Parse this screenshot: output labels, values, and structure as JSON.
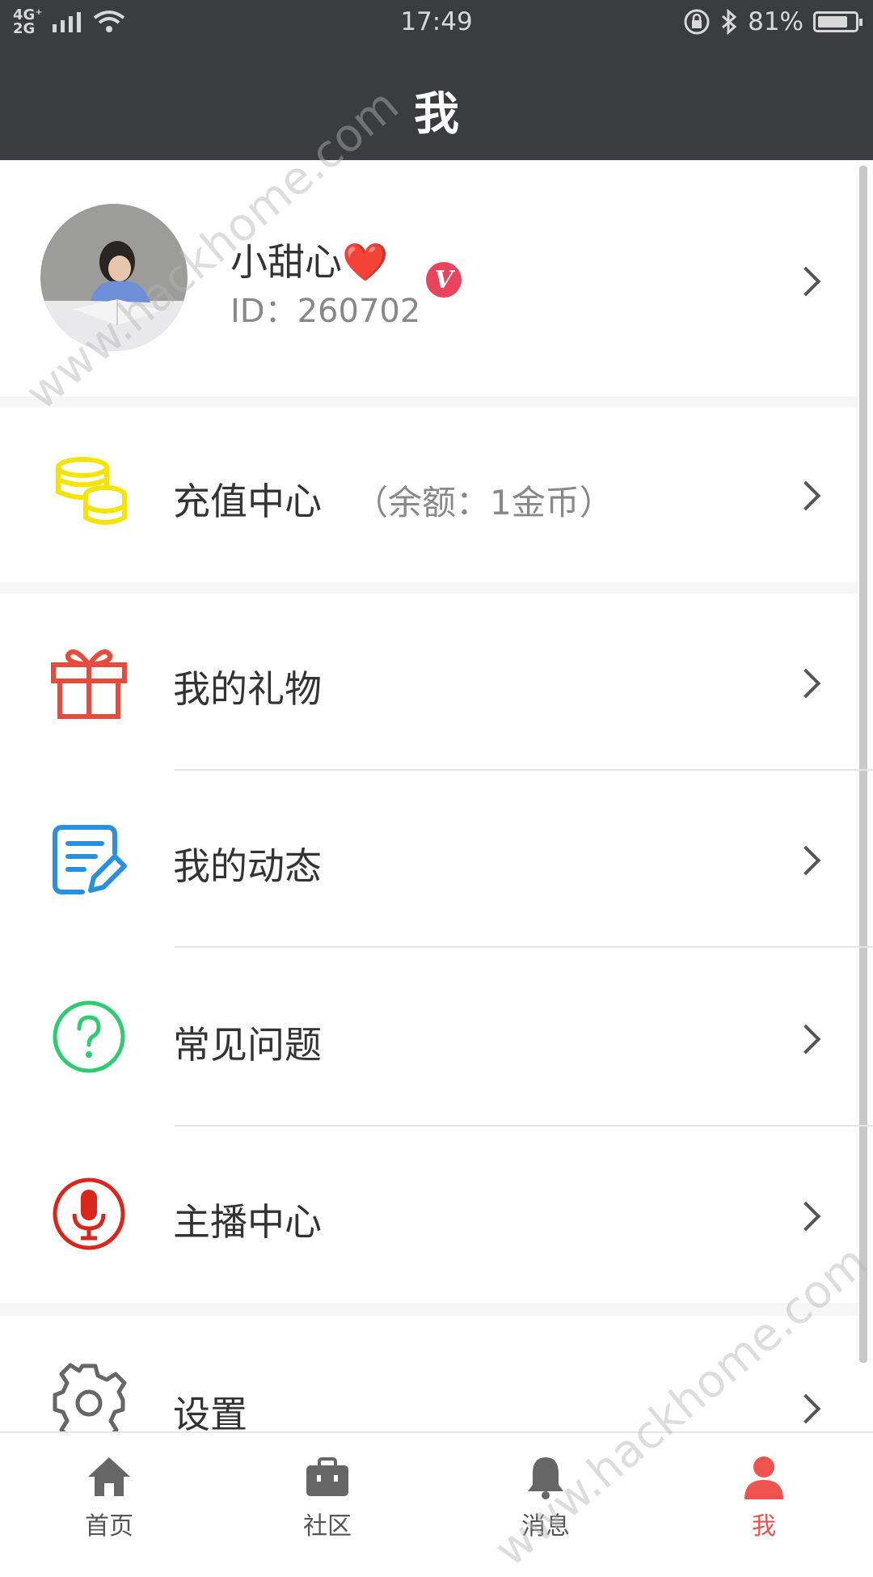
{
  "status_bar": {
    "network_top": "4G⁺",
    "network_bottom": "2G",
    "time": "17:49",
    "battery_percent": "81%",
    "battery_level": 0.81
  },
  "header": {
    "title": "我"
  },
  "profile": {
    "nickname": "小甜心❤️",
    "id_text": "ID：260702",
    "vip_badge": "V"
  },
  "menu": {
    "recharge": {
      "label": "充值中心",
      "balance": "（余额：1金币）"
    },
    "gifts": {
      "label": "我的礼物"
    },
    "posts": {
      "label": "我的动态"
    },
    "faq": {
      "label": "常见问题"
    },
    "streamer": {
      "label": "主播中心"
    },
    "settings": {
      "label": "设置"
    }
  },
  "bottom_nav": [
    {
      "label": "首页",
      "icon": "home-icon"
    },
    {
      "label": "社区",
      "icon": "briefcase-icon"
    },
    {
      "label": "消息",
      "icon": "bell-icon"
    },
    {
      "label": "我",
      "icon": "person-icon",
      "active": true
    }
  ],
  "colors": {
    "header_bg": "#3b3c40",
    "active_tab": "#ef5350",
    "coin_icon": "#f5e400",
    "gift_icon": "#e84b3c",
    "posts_icon": "#2a8fdc",
    "faq_icon": "#2ecc71",
    "streamer_icon": "#d9261c"
  },
  "watermark": "www.hackhome.com"
}
